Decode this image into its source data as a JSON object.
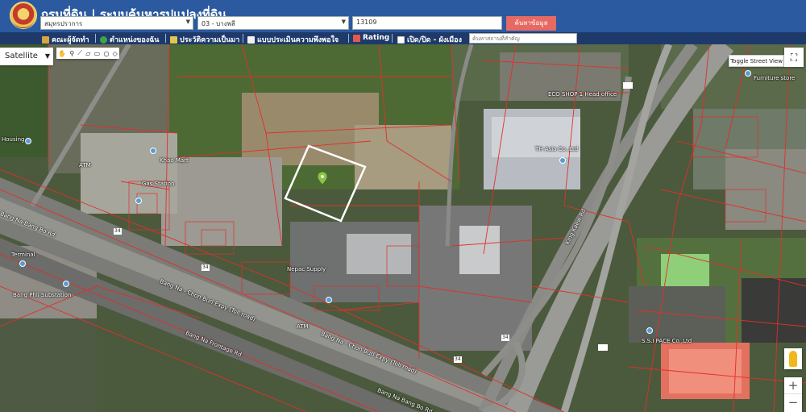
{
  "header": {
    "title": "กรมที่ดิน | ระบบค้นหารูปแปลงที่ดิน",
    "province": "สมุทรปราการ",
    "district": "03 - บางพลี",
    "parcel_value": "13109",
    "search_label": "ค้นหาข้อมูล"
  },
  "toolbar": {
    "items": [
      {
        "label": "คณะผู้จัดทำ"
      },
      {
        "label": "ตำแหน่งของฉัน"
      },
      {
        "label": "ประวัติความเป็นมา"
      },
      {
        "label": "แบบประเมินความพึงพอใจ"
      },
      {
        "label": "Rating"
      },
      {
        "label": "เปิด/ปิด - ผังเมือง"
      }
    ],
    "place_placeholder": "ค้นหาสถานที่สำคัญ"
  },
  "map": {
    "map_type": "Satellite",
    "toggle_street_view": "Toggle Street View",
    "zoom_in": "+",
    "zoom_out": "−",
    "labels": {
      "housing": "Housing",
      "atm_left": "ATM",
      "khao_mart": "Khao Mart",
      "gas_station": "Gas Station",
      "bang_na_road": "Bang Na-Bang Bo Rd",
      "terminal": "Terminal",
      "substation": "Bang Phli Substation",
      "bang_na_toll_1": "Bang Na - Chon Buri Expy (Toll road)",
      "bang_na_frontage": "Bang Na Frontage Rd",
      "bang_na_toll_2": "Bang Na - Chon Buri Expy (Toll road)",
      "bang_na_road_2": "Bang Na Bang Bo Rd",
      "eco_shop": "ECO SHOP 1 Head office",
      "th_asia": "TH Asia Co.,Ltd",
      "king_kaew": "King Kaew Rd",
      "furniture": "Furniture store",
      "ssi_pace": "S.S.I PACE Co.,Ltd",
      "nepac": "Nepac Supply",
      "atm_bottom": "ATM",
      "route_34a": "34",
      "route_34b": "34",
      "route_34c": "34",
      "route_34d": "34"
    }
  }
}
